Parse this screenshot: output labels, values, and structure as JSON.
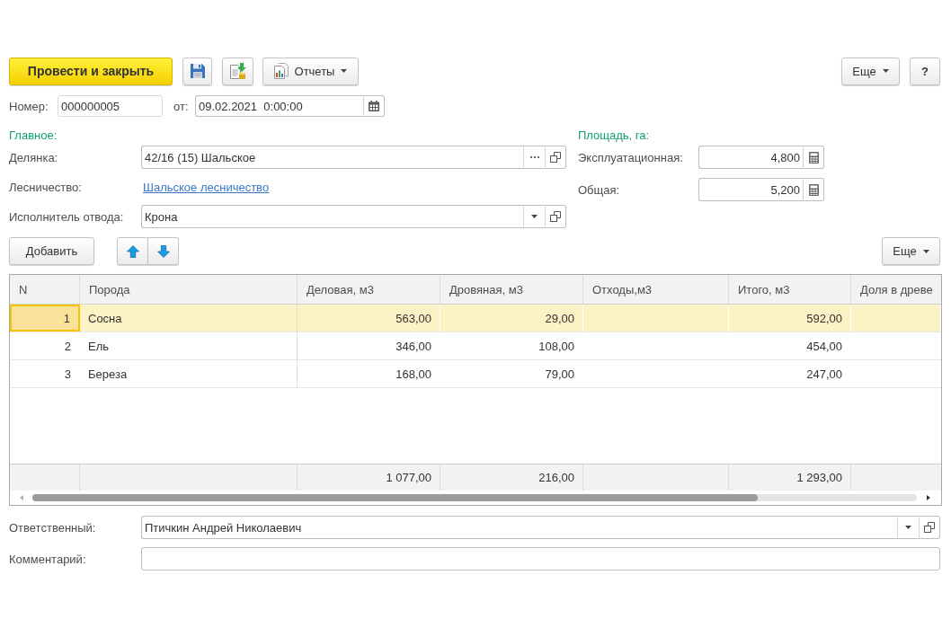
{
  "toolbar": {
    "post_and_close": "Провести и закрыть",
    "reports": "Отчеты",
    "more": "Еще",
    "help": "?"
  },
  "header": {
    "number": {
      "label": "Номер:",
      "value": "000000005"
    },
    "date": {
      "label": "от:",
      "value": "09.02.2021  0:00:00"
    }
  },
  "main_section": {
    "title": "Главное:",
    "fields": [
      {
        "kind": "choice",
        "label": "Делянка:",
        "value": "42/16 (15) Шальское"
      },
      {
        "kind": "link",
        "label": "Лесничество:",
        "value": "Шальское лесничество"
      },
      {
        "kind": "dropdown",
        "label": "Исполнитель отвода:",
        "value": "Крона"
      }
    ]
  },
  "area_section": {
    "title": "Площадь, га:",
    "fields": [
      {
        "label": "Эксплуатационная:",
        "value": "4,800"
      },
      {
        "label": "Общая:",
        "value": "5,200"
      }
    ]
  },
  "table_toolbar": {
    "add": "Добавить",
    "more": "Еще"
  },
  "table": {
    "columns": [
      "N",
      "Порода",
      "Деловая, м3",
      "Дровяная, м3",
      "Отходы,м3",
      "Итого, м3",
      "Доля в древе"
    ],
    "rows": [
      {
        "selected": true,
        "focused": true,
        "n": "1",
        "species": "Сосна",
        "commercial": "563,00",
        "firewood": "29,00",
        "total": "592,00"
      },
      {
        "selected": false,
        "focused": false,
        "n": "2",
        "species": "Ель",
        "commercial": "346,00",
        "firewood": "108,00",
        "total": "454,00"
      },
      {
        "selected": false,
        "focused": false,
        "n": "3",
        "species": "Береза",
        "commercial": "168,00",
        "firewood": "79,00",
        "total": "247,00"
      }
    ],
    "totals": {
      "commercial": "1 077,00",
      "firewood": "216,00",
      "total": "1 293,00"
    }
  },
  "responsible": {
    "label": "Ответственный:",
    "value": "Птичкин Андрей Николаевич"
  },
  "comment": {
    "label": "Комментарий:"
  }
}
